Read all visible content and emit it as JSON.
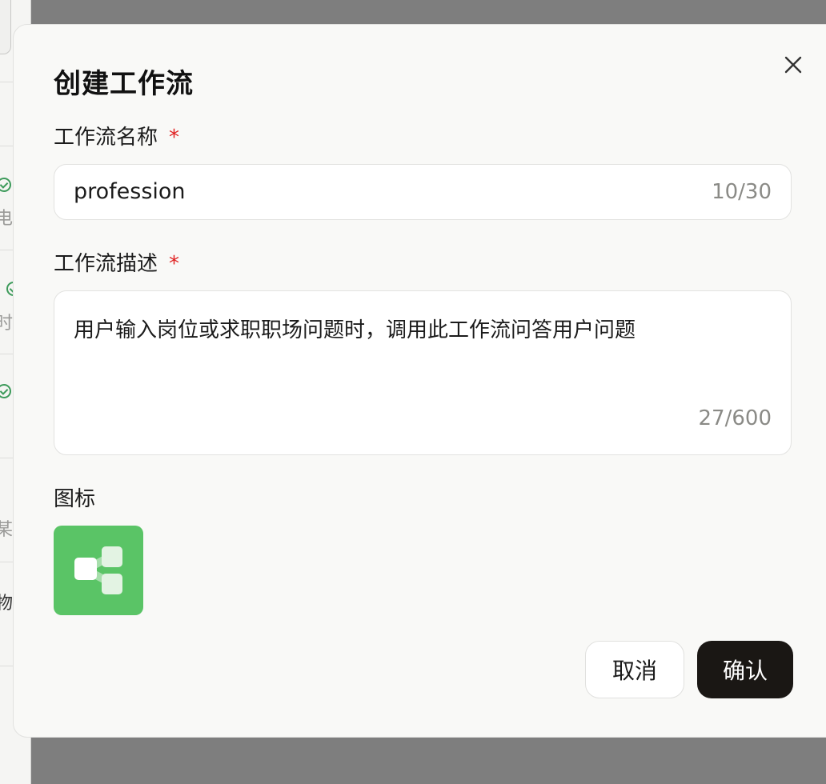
{
  "background": {
    "row_chars": [
      "电",
      "时",
      "某",
      "物"
    ]
  },
  "dialog": {
    "title": "创建工作流",
    "close_icon": "close-icon",
    "name_field": {
      "label": "工作流名称",
      "required_mark": "*",
      "value": "profession",
      "counter": "10/30"
    },
    "description_field": {
      "label": "工作流描述",
      "required_mark": "*",
      "value": "用户输入岗位或求职职场问题时，调用此工作流问答用户问题",
      "counter": "27/600"
    },
    "icon_section": {
      "label": "图标",
      "icon": "workflow-nodes-icon",
      "color": "#5ac466"
    },
    "buttons": {
      "cancel": "取消",
      "confirm": "确认"
    }
  }
}
